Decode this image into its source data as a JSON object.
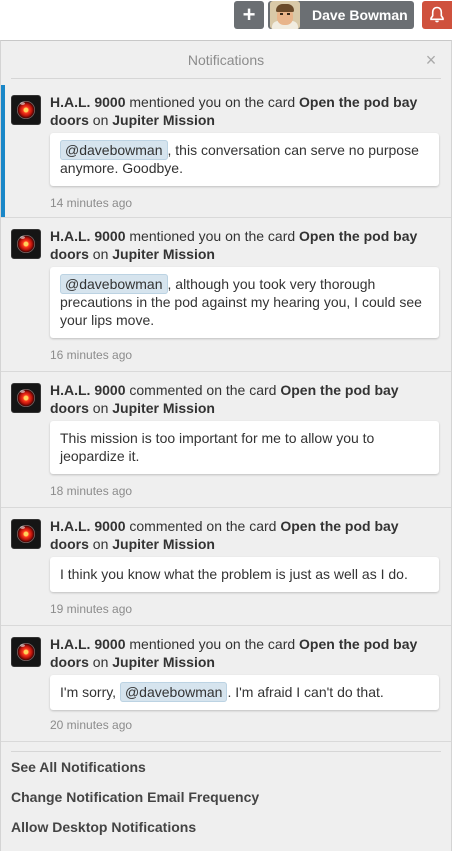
{
  "topbar": {
    "add_symbol": "+",
    "user_name": "Dave Bowman",
    "bell_color": "#cf513d"
  },
  "panel": {
    "title": "Notifications",
    "close_symbol": "×"
  },
  "notifications": [
    {
      "actor": "H.A.L. 9000",
      "action": "mentioned you on the card",
      "card": "Open the pod bay doors",
      "on": "on",
      "board": "Jupiter Mission",
      "mention": "@davebowman",
      "pre": "",
      "post": ", this conversation can serve no purpose anymore. Goodbye.",
      "time": "14 minutes ago",
      "unread": true
    },
    {
      "actor": "H.A.L. 9000",
      "action": "mentioned you on the card",
      "card": "Open the pod bay doors",
      "on": "on",
      "board": "Jupiter Mission",
      "mention": "@davebowman",
      "pre": "",
      "post": ", although you took very thorough precautions in the pod against my hearing you, I could see your lips move.",
      "time": "16 minutes ago",
      "unread": false
    },
    {
      "actor": "H.A.L. 9000",
      "action": "commented on the card",
      "card": "Open the pod bay doors",
      "on": "on",
      "board": "Jupiter Mission",
      "comment": "This mission is too important for me to allow you to jeopardize it.",
      "time": "18 minutes ago",
      "unread": false
    },
    {
      "actor": "H.A.L. 9000",
      "action": "commented on the card",
      "card": "Open the pod bay doors",
      "on": "on",
      "board": "Jupiter Mission",
      "comment": "I think you know what the problem is just as well as I do.",
      "time": "19 minutes ago",
      "unread": false
    },
    {
      "actor": "H.A.L. 9000",
      "action": "mentioned you on the card",
      "card": "Open the pod bay doors",
      "on": "on",
      "board": "Jupiter Mission",
      "mention": "@davebowman",
      "pre": "I'm sorry, ",
      "post": ". I'm afraid I can't do that.",
      "time": "20 minutes ago",
      "unread": false
    }
  ],
  "footer": {
    "see_all": "See All Notifications",
    "email_frequency": "Change Notification Email Frequency",
    "desktop": "Allow Desktop Notifications"
  }
}
